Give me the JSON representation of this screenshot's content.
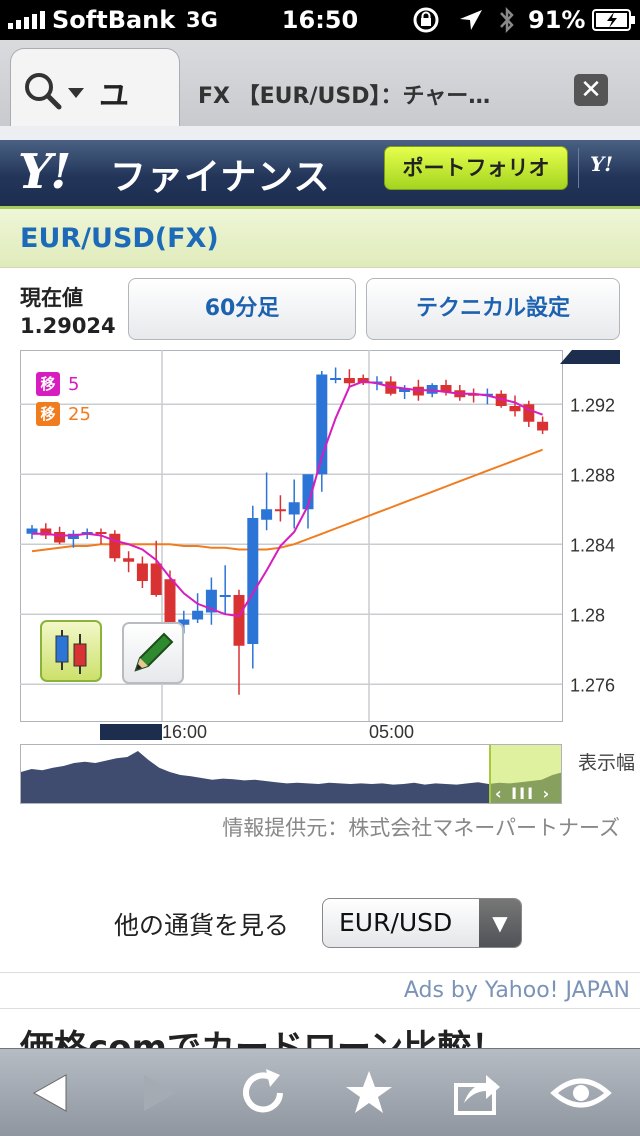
{
  "status": {
    "carrier": "SoftBank",
    "network": "3G",
    "time": "16:50",
    "battery": "91%"
  },
  "browser": {
    "search_text": "ユ",
    "page_title": "FX 【EUR/USD】：チャー…",
    "close": "✕"
  },
  "site": {
    "logo": "Y!",
    "title": "ファイナンス",
    "portfolio_label": "ポートフォリオ",
    "small_logo": "Y!"
  },
  "pair": {
    "title": "EUR/USD(FX)"
  },
  "quote": {
    "label": "現在値",
    "value": "1.29024"
  },
  "buttons": {
    "interval": "60分足",
    "technical": "テクニカル設定"
  },
  "legend": [
    {
      "badge": "移",
      "period": "5",
      "color": "#d71cc0"
    },
    {
      "badge": "移",
      "period": "25",
      "color": "#f07c1e"
    }
  ],
  "chart_data": {
    "type": "candlestick",
    "y_ticks": [
      "1.292",
      "1.288",
      "1.284",
      "1.28",
      "1.276"
    ],
    "ylim": [
      1.2739,
      1.2951
    ],
    "x_ticks": [
      {
        "label": "16:00",
        "index": 10
      },
      {
        "label": "05:00",
        "index": 25
      }
    ],
    "up_color": "#2c74d6",
    "down_color": "#d93232",
    "ma5_color": "#d71cc0",
    "ma25_color": "#f07c1e",
    "candles": [
      [
        1.2846,
        1.2851,
        1.2843,
        1.2849
      ],
      [
        1.2849,
        1.2852,
        1.2843,
        1.2845
      ],
      [
        1.2847,
        1.285,
        1.284,
        1.2841
      ],
      [
        1.2843,
        1.2848,
        1.2838,
        1.2846
      ],
      [
        1.2846,
        1.2849,
        1.2843,
        1.2847
      ],
      [
        1.2847,
        1.2849,
        1.284,
        1.2846
      ],
      [
        1.2846,
        1.2848,
        1.283,
        1.2832
      ],
      [
        1.2832,
        1.2836,
        1.2824,
        1.283
      ],
      [
        1.2829,
        1.2833,
        1.2815,
        1.2819
      ],
      [
        1.2829,
        1.2842,
        1.281,
        1.2811
      ],
      [
        1.282,
        1.2825,
        1.2787,
        1.2794
      ],
      [
        1.2794,
        1.2802,
        1.2789,
        1.2797
      ],
      [
        1.2797,
        1.2812,
        1.2795,
        1.2802
      ],
      [
        1.2801,
        1.2821,
        1.2794,
        1.2814
      ],
      [
        1.2811,
        1.2828,
        1.28,
        1.2811
      ],
      [
        1.2811,
        1.2814,
        1.2754,
        1.2782
      ],
      [
        1.2783,
        1.2862,
        1.2769,
        1.2855
      ],
      [
        1.2854,
        1.2881,
        1.2848,
        1.286
      ],
      [
        1.286,
        1.2868,
        1.2853,
        1.2859
      ],
      [
        1.2857,
        1.2877,
        1.2849,
        1.2864
      ],
      [
        1.286,
        1.2879,
        1.2849,
        1.288
      ],
      [
        1.288,
        1.2939,
        1.287,
        1.2937
      ],
      [
        1.2935,
        1.2941,
        1.2932,
        1.2935
      ],
      [
        1.2935,
        1.294,
        1.293,
        1.2932
      ],
      [
        1.2935,
        1.2937,
        1.2931,
        1.2932
      ],
      [
        1.2932,
        1.2936,
        1.2928,
        1.2933
      ],
      [
        1.2933,
        1.2936,
        1.2925,
        1.2926
      ],
      [
        1.2927,
        1.2931,
        1.2923,
        1.2929
      ],
      [
        1.293,
        1.2934,
        1.2922,
        1.2925
      ],
      [
        1.2926,
        1.2932,
        1.2924,
        1.2931
      ],
      [
        1.2931,
        1.2934,
        1.2925,
        1.2927
      ],
      [
        1.2928,
        1.2931,
        1.2922,
        1.2924
      ],
      [
        1.2926,
        1.2929,
        1.2921,
        1.2925
      ],
      [
        1.2925,
        1.2929,
        1.292,
        1.2926
      ],
      [
        1.2926,
        1.2928,
        1.2918,
        1.2919
      ],
      [
        1.2919,
        1.2925,
        1.2913,
        1.2916
      ],
      [
        1.292,
        1.2922,
        1.2907,
        1.291
      ],
      [
        1.291,
        1.2913,
        1.2903,
        1.2905
      ]
    ],
    "ma5": [
      1.2846,
      1.2846,
      1.2845,
      1.2845,
      1.2846,
      1.2845,
      1.2842,
      1.284,
      1.2837,
      1.2831,
      1.2821,
      1.2812,
      1.2806,
      1.2803,
      1.28,
      1.2799,
      1.2812,
      1.2825,
      1.2839,
      1.2847,
      1.2862,
      1.289,
      1.2912,
      1.293,
      1.2933,
      1.2932,
      1.293,
      1.2929,
      1.2928,
      1.2928,
      1.2927,
      1.2926,
      1.2926,
      1.2925,
      1.2923,
      1.2921,
      1.2917,
      1.2914
    ],
    "ma25": [
      1.2836,
      1.2837,
      1.2838,
      1.2839,
      1.2839,
      1.284,
      1.284,
      1.284,
      1.284,
      1.284,
      1.284,
      1.2839,
      1.2839,
      1.2838,
      1.2838,
      1.2837,
      1.2837,
      1.2837,
      1.2838,
      1.284,
      1.2843,
      1.2846,
      1.2849,
      1.2852,
      1.2855,
      1.2858,
      1.2861,
      1.2864,
      1.2867,
      1.287,
      1.2873,
      1.2876,
      1.2879,
      1.2882,
      1.2885,
      1.2888,
      1.2891,
      1.2894
    ],
    "overview_levels": [
      0.55,
      0.6,
      0.58,
      0.62,
      0.65,
      0.7,
      0.72,
      0.7,
      0.74,
      0.78,
      0.8,
      0.9,
      0.75,
      0.62,
      0.55,
      0.5,
      0.48,
      0.45,
      0.42,
      0.44,
      0.43,
      0.41,
      0.42,
      0.4,
      0.38,
      0.36,
      0.37,
      0.36,
      0.35,
      0.37,
      0.36,
      0.35,
      0.36,
      0.35,
      0.36,
      0.34,
      0.35,
      0.37,
      0.34,
      0.36,
      0.35,
      0.34,
      0.36,
      0.38,
      0.35,
      0.37,
      0.36,
      0.38,
      0.4,
      0.42,
      0.5,
      0.55
    ]
  },
  "range": {
    "label": "表示幅"
  },
  "provider": "情報提供元：株式会社マネーパートナーズ",
  "other_currency": {
    "label": "他の通貨を見る",
    "selected": "EUR/USD"
  },
  "ads": {
    "label": "Ads by Yahoo! JAPAN",
    "text": "価格comでカードローン比較！"
  },
  "toolbar": {
    "back": "back-icon",
    "forward": "forward-icon",
    "reload": "reload-icon",
    "bookmark": "star-icon",
    "share": "share-icon",
    "reader": "eye-icon"
  }
}
